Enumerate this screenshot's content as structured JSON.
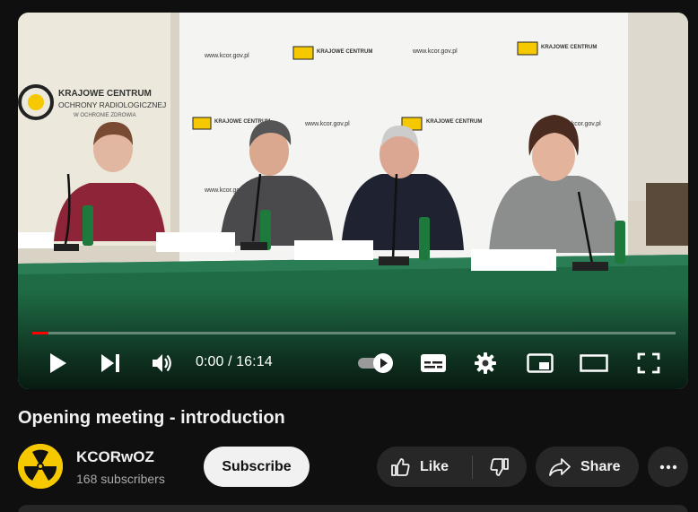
{
  "player": {
    "time_current": "0:00",
    "time_total": "16:14",
    "time_display": "0:00 / 16:14",
    "progress_fraction": 0.025,
    "buttons": {
      "play": "play-icon",
      "next": "next-icon",
      "volume": "volume-icon",
      "autoplay": "autoplay-toggle-icon",
      "subtitles": "subtitles-icon",
      "settings": "gear-icon",
      "miniplayer": "miniplayer-icon",
      "theater": "theater-mode-icon",
      "fullscreen": "fullscreen-icon"
    },
    "scene": {
      "banner_brand_line1": "KRAJOWE CENTRUM",
      "banner_brand_line2": "OCHRONY RADIOLOGICZNEJ",
      "banner_brand_line3": "W OCHRONIE ZDROWIA",
      "banner_url": "www.kcor.gov.pl"
    }
  },
  "video": {
    "title": "Opening meeting - introduction"
  },
  "channel": {
    "name": "KCORwOZ",
    "subscribers": "168 subscribers",
    "avatar": "radiation-logo-icon"
  },
  "actions": {
    "subscribe_label": "Subscribe",
    "like_label": "Like",
    "share_label": "Share"
  },
  "colors": {
    "background": "#0f0f0f",
    "pill": "#272727",
    "progress": "#ff0000",
    "subscribe_bg": "#f1f1f1",
    "avatar_yellow": "#f6c800",
    "table_green": "#1f6b45"
  }
}
